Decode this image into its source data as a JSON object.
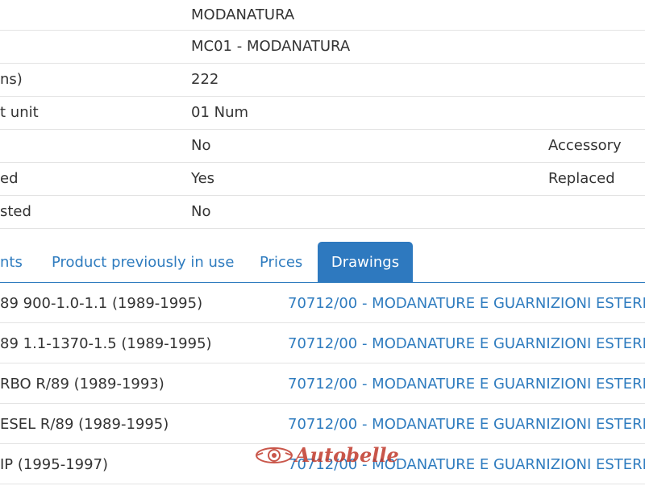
{
  "properties": [
    {
      "label": "",
      "value": "MODANATURA",
      "extra": ""
    },
    {
      "label": "",
      "value": "MC01 - MODANATURA",
      "extra": ""
    },
    {
      "label": "ns)",
      "value": "222",
      "extra": ""
    },
    {
      "label": "t unit",
      "value": "01 Num",
      "extra": ""
    },
    {
      "label": "",
      "value": "No",
      "extra": "Accessory"
    },
    {
      "label": "ed",
      "value": "Yes",
      "extra": "Replaced"
    },
    {
      "label": "sted",
      "value": "No",
      "extra": ""
    }
  ],
  "tabs": [
    {
      "label": "nts",
      "active": false
    },
    {
      "label": "Product previously in use",
      "active": false
    },
    {
      "label": "Prices",
      "active": false
    },
    {
      "label": "Drawings",
      "active": true
    }
  ],
  "drawings": [
    {
      "model": "89 900-1.0-1.1 (1989-1995)",
      "drawing": "70712/00 - MODANATURE E GUARNIZIONI ESTERN"
    },
    {
      "model": "89 1.1-1370-1.5 (1989-1995)",
      "drawing": "70712/00 - MODANATURE E GUARNIZIONI ESTERN"
    },
    {
      "model": "RBO R/89 (1989-1993)",
      "drawing": "70712/00 - MODANATURE E GUARNIZIONI ESTERN"
    },
    {
      "model": "ESEL R/89 (1989-1995)",
      "drawing": "70712/00 - MODANATURE E GUARNIZIONI ESTERN"
    },
    {
      "model": "IP (1995-1997)",
      "drawing": "70712/00 - MODANATURE E GUARNIZIONI ESTERN"
    }
  ],
  "watermark": {
    "text": "Autobelle",
    "icon": "autobelle-logo-icon"
  },
  "colors": {
    "accent": "#2f7cbf",
    "active_tab_bg": "#2e79bf",
    "border": "#e3e3e3",
    "text": "#333333",
    "watermark": "#c0392b"
  }
}
